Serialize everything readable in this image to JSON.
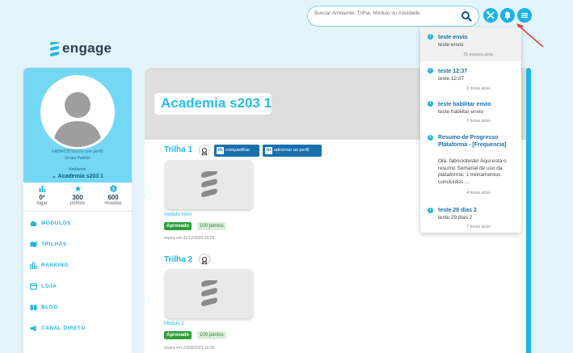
{
  "header": {
    "search_placeholder": "Buscar Ambiente, Trilha, Módulo ou Atividade",
    "icons": [
      "search-icon",
      "tools-icon",
      "bell-icon",
      "menu-icon"
    ],
    "accent_color": "#18b4e3"
  },
  "logo": {
    "text": "engage"
  },
  "profile": {
    "name": "FABRICIOTESTE",
    "edit_link": "(ver perfil)",
    "group": "Grupo Padrão",
    "environment_label": "Ambiente",
    "environment_value": "Academia s203 1"
  },
  "stats": [
    {
      "icon": "bar-chart-icon",
      "value": "0º",
      "label": "lugar"
    },
    {
      "icon": "star-icon",
      "value": "300",
      "label": "pontos"
    },
    {
      "icon": "coin-icon",
      "value": "600",
      "label": "moedas"
    }
  ],
  "menu": [
    {
      "label": "MÓDULOS",
      "icon": "puzzle-icon"
    },
    {
      "label": "TRILHAS",
      "icon": "map-icon"
    },
    {
      "label": "RANKING",
      "icon": "ranking-icon"
    },
    {
      "label": "LOJA",
      "icon": "store-icon"
    },
    {
      "label": "BLOG",
      "icon": "book-icon"
    },
    {
      "label": "CANAL DIRETO",
      "icon": "megaphone-icon"
    }
  ],
  "main": {
    "title": "Academia s203 1",
    "trilhas": [
      {
        "name": "Trilha 1",
        "share_label": "compartilhar",
        "add_profile_label": "adicionar ao perfil",
        "module_name": "modulo novo",
        "status": "Aprovado",
        "points": "100 pontos",
        "expires": "expira em 31/12/2025 23:59"
      },
      {
        "name": "Trilha 2",
        "module_name": "Módulo 1",
        "status": "Aprovado",
        "points": "100 pontos",
        "expires": "expira em 23/08/2025 16:00"
      }
    ]
  },
  "notifications": [
    {
      "title": "teste envio",
      "body": "teste envio",
      "time": "26 minutos atrás"
    },
    {
      "title": "teste 12:37",
      "body": "teste 12:37",
      "time": "3 horas atrás"
    },
    {
      "title": "teste habilitar envio",
      "body": "teste habilitar envio",
      "time": "3 horas atrás"
    },
    {
      "title": "Resumo de Progresso Plataforma - [Frequencia]",
      "body": "Olá, fabricioteste! Aqui está o resumo Semanal de uso da plataforma: 1 treinamentos concluídos ...",
      "time": "4 horas atrás"
    },
    {
      "title": "teste 29 dias 2",
      "body": "teste 29 dias 2",
      "time": "7 horas atrás"
    }
  ]
}
